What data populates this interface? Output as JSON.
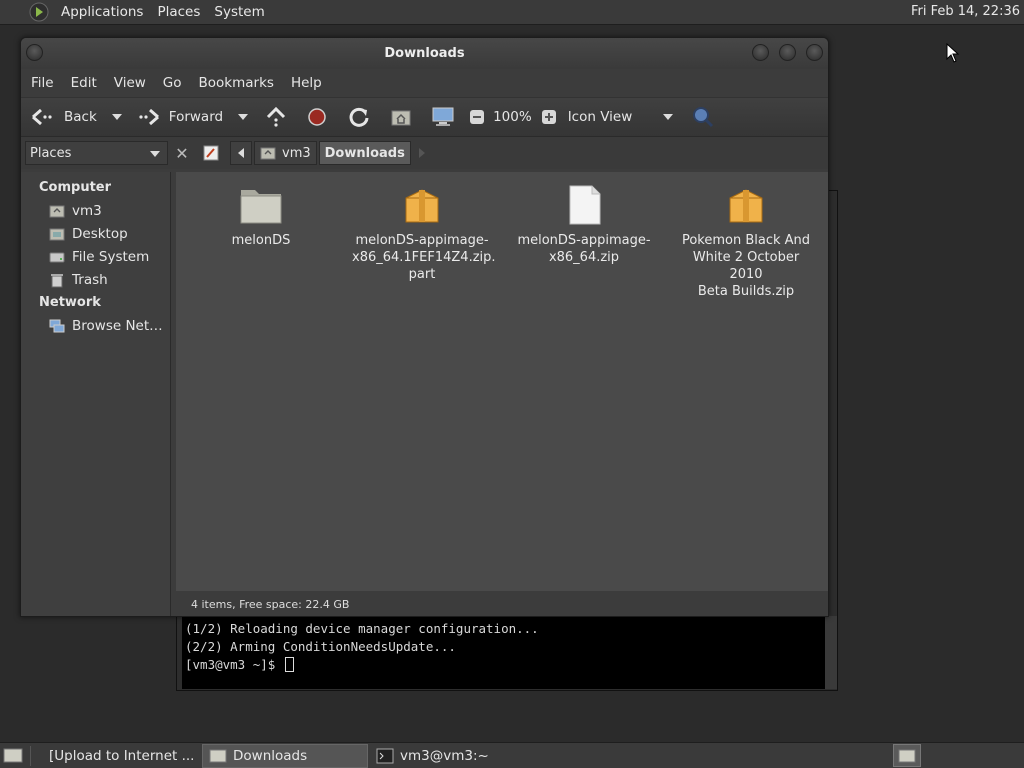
{
  "top_panel": {
    "menus": [
      "Applications",
      "Places",
      "System"
    ],
    "clock": "Fri Feb 14, 22:36"
  },
  "window": {
    "title": "Downloads",
    "menubar": [
      "File",
      "Edit",
      "View",
      "Go",
      "Bookmarks",
      "Help"
    ],
    "toolbar": {
      "back_label": "Back",
      "forward_label": "Forward",
      "zoom_level": "100%",
      "view_mode": "Icon View"
    },
    "location": {
      "sidebar_mode": "Places",
      "breadcrumbs": [
        "vm3",
        "Downloads"
      ]
    },
    "sidebar": {
      "sections": [
        {
          "heading": "Computer",
          "items": [
            "vm3",
            "Desktop",
            "File System",
            "Trash"
          ]
        },
        {
          "heading": "Network",
          "items": [
            "Browse Net…"
          ]
        }
      ]
    },
    "files": [
      {
        "name": "melonDS",
        "kind": "folder"
      },
      {
        "name": "melonDS-appimage-x86_64.1FEF14Z4.zip.part",
        "display": [
          "melonDS-appimage-",
          "x86_64.1FEF14Z4.zip.",
          "part"
        ],
        "kind": "archive"
      },
      {
        "name": "melonDS-appimage-x86_64.zip",
        "display": [
          "melonDS-appimage-",
          "x86_64.zip"
        ],
        "kind": "file"
      },
      {
        "name": "Pokemon Black And White 2 October 2010 Beta Builds.zip",
        "display": [
          "Pokemon Black And",
          "White 2 October 2010",
          "Beta Builds.zip"
        ],
        "kind": "archive"
      }
    ],
    "status": "4 items, Free space: 22.4 GB"
  },
  "terminal": {
    "lines": [
      "(1/2) Reloading device manager configuration...",
      "(2/2) Arming ConditionNeedsUpdate..."
    ],
    "prompt": "[vm3@vm3 ~]$ "
  },
  "taskbar": {
    "tasks": [
      "[Upload to Internet ...",
      "Downloads",
      "vm3@vm3:~"
    ],
    "active": "Downloads"
  },
  "colors": {
    "panel_bg": "#3a3a3a",
    "window_bg": "#3c3c3c",
    "content_bg": "#4a4a4a",
    "folder_fill": "#cfcfc4",
    "archive_fill": "#f0b24a",
    "stop_red": "#c0392b"
  }
}
